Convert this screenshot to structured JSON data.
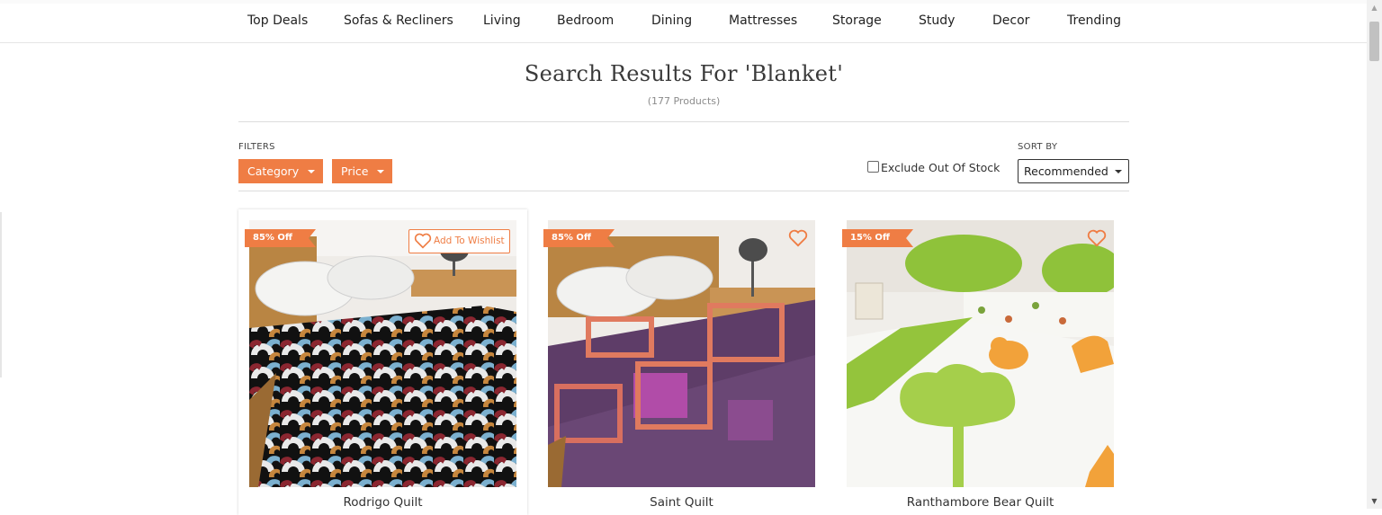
{
  "nav": {
    "items": [
      "Top Deals",
      "Sofas & Recliners",
      "Living",
      "Bedroom",
      "Dining",
      "Mattresses",
      "Storage",
      "Study",
      "Decor",
      "Trending"
    ]
  },
  "search": {
    "title": "Search Results For 'Blanket'",
    "count": "(177 Products)"
  },
  "filters": {
    "label": "FILTERS",
    "category": "Category",
    "price": "Price",
    "exclude_label": "Exclude Out Of Stock"
  },
  "sort": {
    "label": "SORT BY",
    "selected": "Recommended"
  },
  "products": [
    {
      "name": "Rodrigo Quilt",
      "discount": "85% Off",
      "wishlist": "Add To Wishlist"
    },
    {
      "name": "Saint Quilt",
      "discount": "85% Off"
    },
    {
      "name": "Ranthambore Bear Quilt",
      "discount": "15% Off"
    }
  ],
  "colors": {
    "accent": "#ef7d44"
  }
}
